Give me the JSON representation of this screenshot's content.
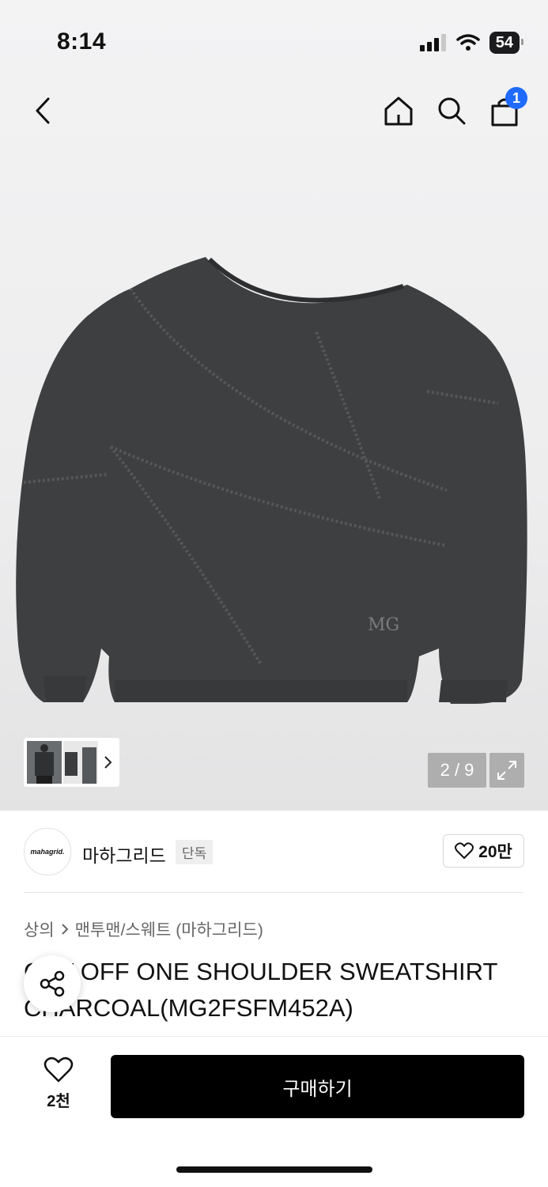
{
  "status_bar": {
    "time": "8:14",
    "battery": "54"
  },
  "header": {
    "cart_count": "1"
  },
  "gallery": {
    "counter": "2 / 9"
  },
  "brand": {
    "logo_text": "mahagrid.",
    "name": "마하그리드",
    "tag": "단독",
    "likes": "20만"
  },
  "breadcrumb": {
    "category": "상의",
    "subcategory": "맨투맨/스웨트 (마하그리드)"
  },
  "product": {
    "title": "CUT OFF ONE SHOULDER SWEATSHIRT CHARCOAL(MG2FSFM452A)"
  },
  "bottom": {
    "wish_count": "2천",
    "buy_label": "구매하기"
  },
  "colors": {
    "accent": "#1f6bff",
    "product": "#3d3f40",
    "buy_bg": "#000000"
  }
}
